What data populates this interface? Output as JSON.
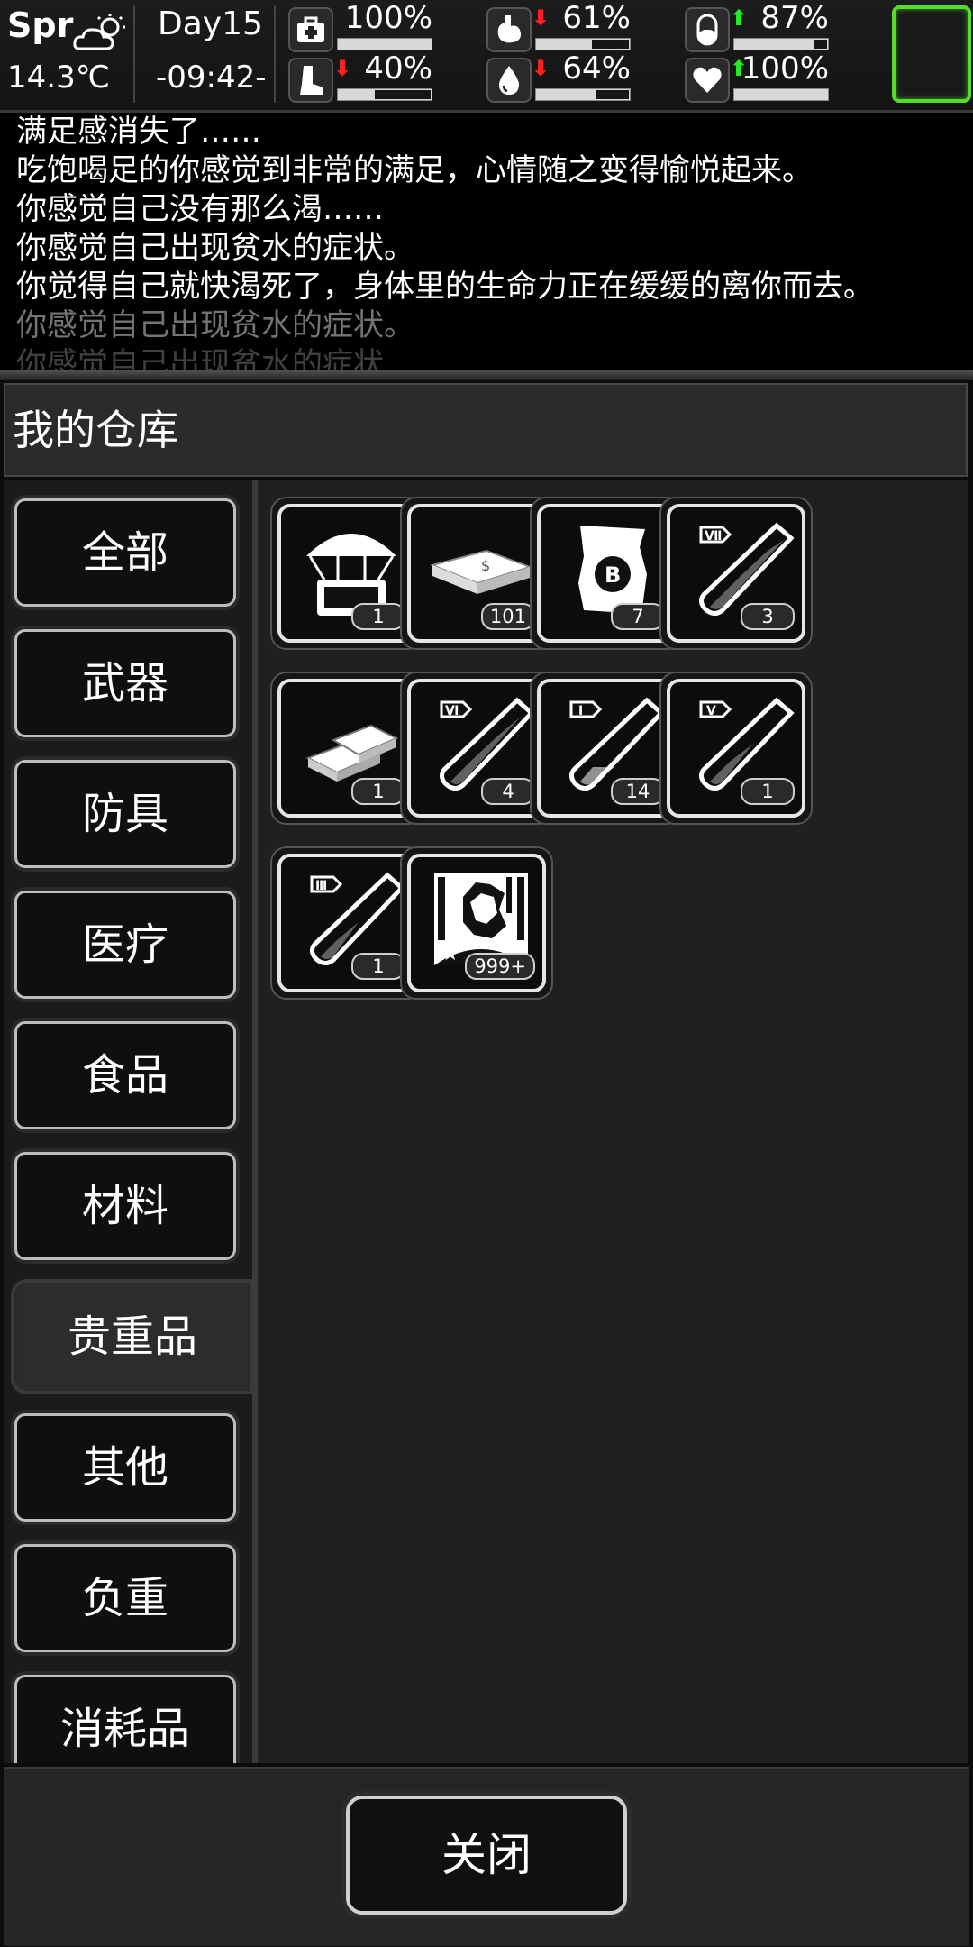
{
  "status": {
    "season": "Spr",
    "temperature": "14.3℃",
    "day": "Day15",
    "time": "-09:42-",
    "weather_icon": "partly-cloudy-icon",
    "stats": [
      {
        "name": "health",
        "icon": "medkit-icon",
        "value": "100%",
        "level": 1.0,
        "trend": ""
      },
      {
        "name": "hunger",
        "icon": "stomach-icon",
        "value": "61%",
        "level": 0.61,
        "trend": "down"
      },
      {
        "name": "medicine",
        "icon": "pill-icon",
        "value": "87%",
        "level": 0.87,
        "trend": "up"
      },
      {
        "name": "stamina",
        "icon": "foot-icon",
        "value": "40%",
        "level": 0.4,
        "trend": "down"
      },
      {
        "name": "thirst",
        "icon": "water-drop-icon",
        "value": "64%",
        "level": 0.64,
        "trend": "down"
      },
      {
        "name": "mood",
        "icon": "heart-icon",
        "value": "100%",
        "level": 1.0,
        "trend": "up"
      }
    ]
  },
  "log": [
    "满足感消失了……",
    "吃饱喝足的你感觉到非常的满足，心情随之变得愉悦起来。",
    "你感觉自己没有那么渴……",
    "你感觉自己出现贫水的症状。",
    "你觉得自己就快渴死了，身体里的生命力正在缓缓的离你而去。",
    "你感觉自己出现贫水的症状。",
    "你感觉自己出现贫水的症状"
  ],
  "panel": {
    "title": "我的仓库"
  },
  "categories": [
    "全部",
    "武器",
    "防具",
    "医疗",
    "食品",
    "材料",
    "贵重品",
    "其他",
    "负重",
    "消耗品"
  ],
  "active_category": "贵重品",
  "items": [
    {
      "icon": "airdrop-crate-icon",
      "count": "1"
    },
    {
      "icon": "cash-stack-icon",
      "count": "101"
    },
    {
      "icon": "coin-voucher-icon",
      "count": "7"
    },
    {
      "icon": "test-tube-vii-icon",
      "roman": "Ⅶ",
      "count": "3"
    },
    {
      "icon": "gold-bars-icon",
      "count": "1"
    },
    {
      "icon": "test-tube-vi-icon",
      "roman": "Ⅵ",
      "count": "4"
    },
    {
      "icon": "test-tube-i-icon",
      "roman": "Ⅰ",
      "count": "14"
    },
    {
      "icon": "test-tube-v-icon",
      "roman": "Ⅴ",
      "count": "1"
    },
    {
      "icon": "test-tube-iii-icon",
      "roman": "Ⅲ",
      "count": "1"
    },
    {
      "icon": "zombie-card-icon",
      "count": "999+"
    }
  ],
  "close_label": "关闭"
}
